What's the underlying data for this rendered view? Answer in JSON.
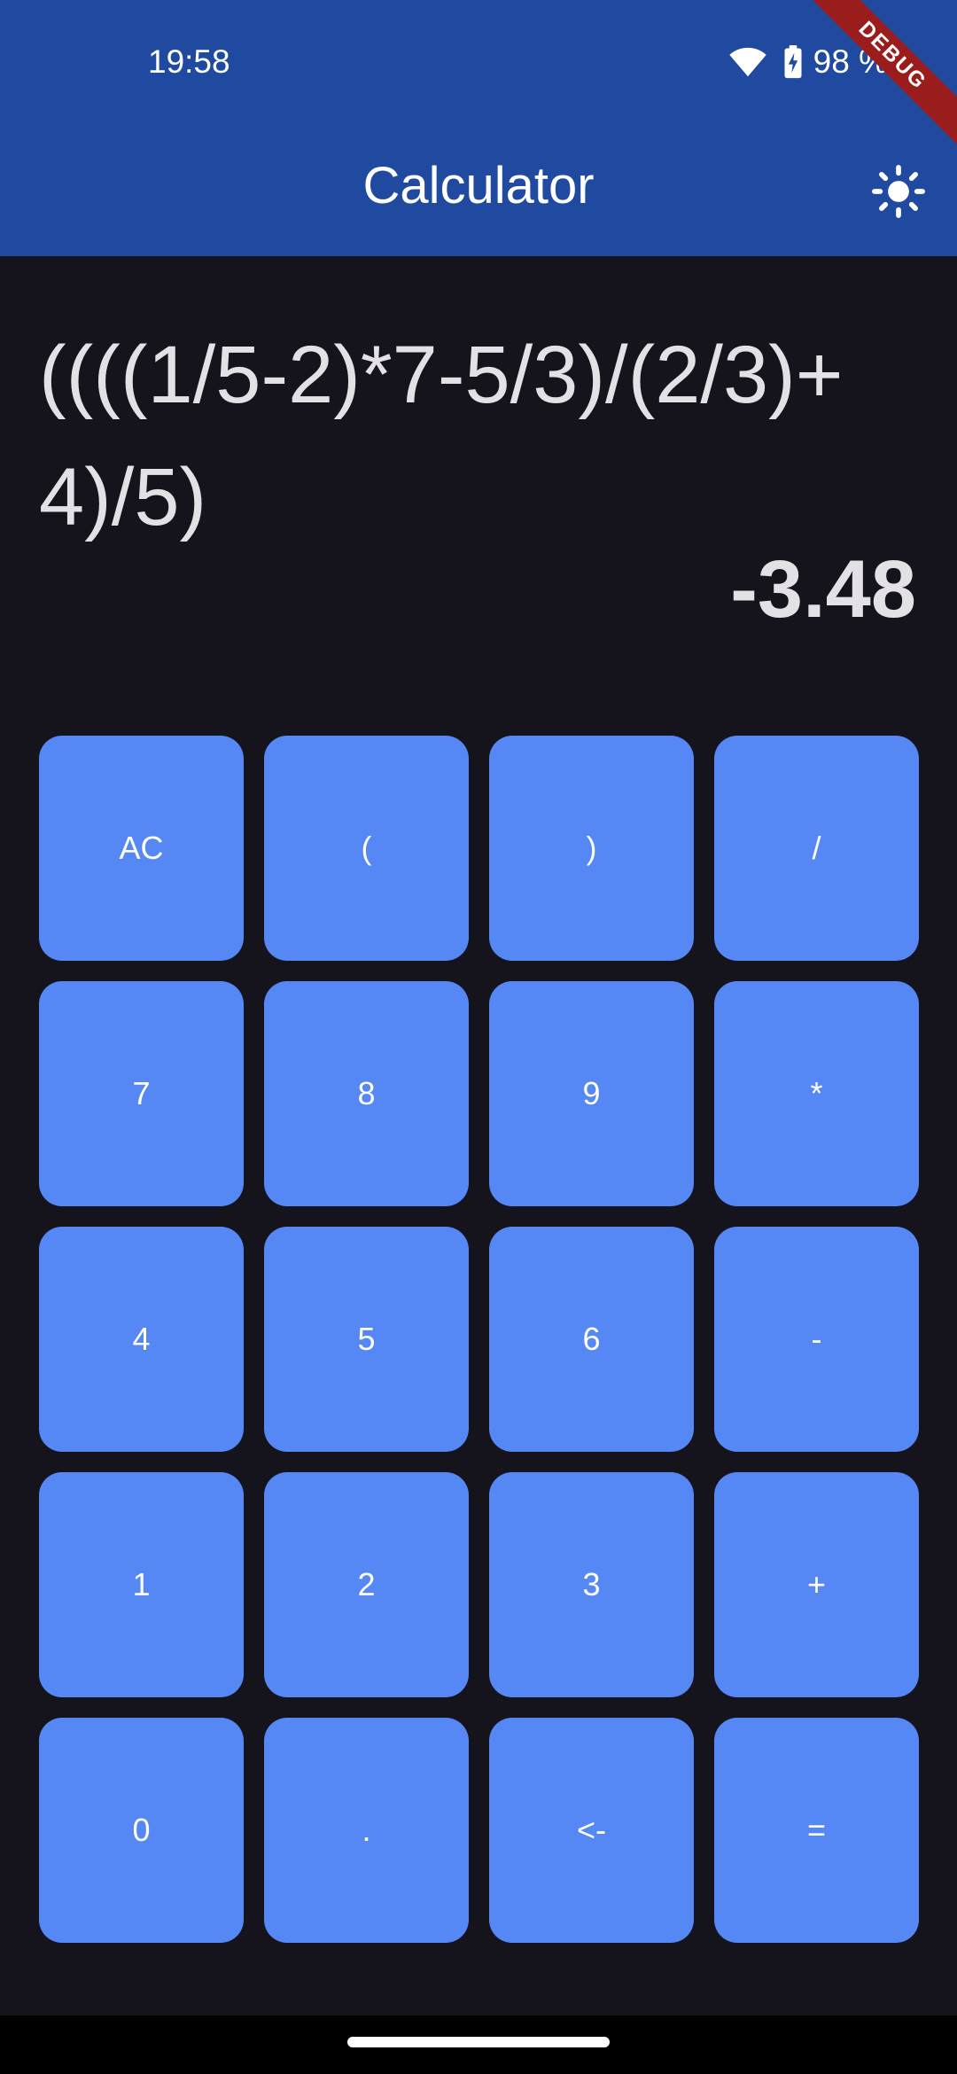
{
  "status_bar": {
    "time": "19:58",
    "battery": "98 %",
    "icons": [
      "wifi-icon",
      "battery-charging-icon"
    ]
  },
  "app_bar": {
    "title": "Calculator",
    "theme_icon": "sun-icon",
    "background": "#1f4aa0"
  },
  "debug_banner": {
    "label": "DEBUG"
  },
  "display": {
    "expression": "((((1/5-2)*7-5/3)/(2/3)+4)/5)",
    "result": "-3.48"
  },
  "keypad": {
    "key_color": "#5587f5",
    "keys": [
      "AC",
      "(",
      ")",
      "/",
      "7",
      "8",
      "9",
      "*",
      "4",
      "5",
      "6",
      "-",
      "1",
      "2",
      "3",
      "+",
      "0",
      ".",
      "<-",
      "="
    ]
  }
}
